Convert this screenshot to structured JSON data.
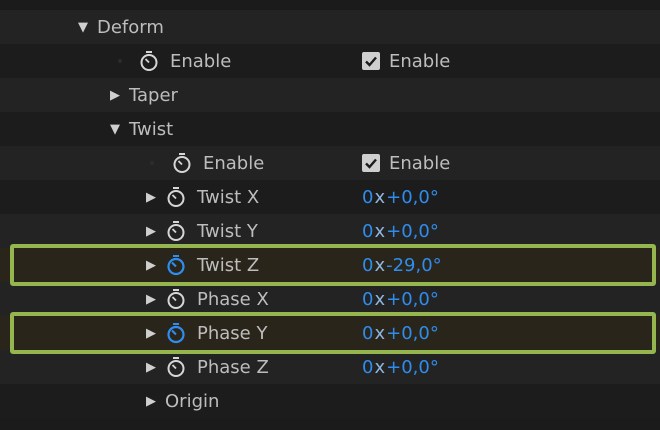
{
  "deform": {
    "label": "Deform",
    "expanded": true
  },
  "deform_enable": {
    "label": "Enable",
    "checkbox_label": "Enable",
    "checked": true
  },
  "taper": {
    "label": "Taper",
    "expanded": false
  },
  "twist": {
    "label": "Twist",
    "expanded": true
  },
  "twist_enable": {
    "label": "Enable",
    "checkbox_label": "Enable",
    "checked": true
  },
  "twist_x": {
    "label": "Twist X",
    "revolutions": "0",
    "x": "x",
    "degrees": "+0,0°"
  },
  "twist_y": {
    "label": "Twist Y",
    "revolutions": "0",
    "x": "x",
    "degrees": "+0,0°"
  },
  "twist_z": {
    "label": "Twist Z",
    "revolutions": "0",
    "x": "x",
    "degrees": "-29,0°",
    "stopwatch_active": true
  },
  "phase_x": {
    "label": "Phase X",
    "revolutions": "0",
    "x": "x",
    "degrees": "+0,0°"
  },
  "phase_y": {
    "label": "Phase Y",
    "revolutions": "0",
    "x": "x",
    "degrees": "+0,0°",
    "stopwatch_active": true
  },
  "phase_z": {
    "label": "Phase Z",
    "revolutions": "0",
    "x": "x",
    "degrees": "+0,0°"
  },
  "origin": {
    "label": "Origin",
    "expanded": false
  },
  "colors": {
    "value_blue": "#2e8ded",
    "stopwatch_active": "#2e8ded",
    "highlight_border": "#95b64e",
    "row_even": "#232323",
    "row_odd": "#1c1c1c"
  }
}
